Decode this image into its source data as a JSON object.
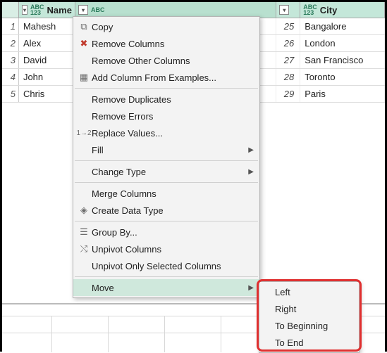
{
  "columns": {
    "name_header": "Name",
    "city_header": "City",
    "type_label": "ABC\n123"
  },
  "rows": [
    {
      "n": "1",
      "name": "Mahesh",
      "age": "25",
      "city": "Bangalore"
    },
    {
      "n": "2",
      "name": "Alex",
      "age": "26",
      "city": "London"
    },
    {
      "n": "3",
      "name": "David",
      "age": "27",
      "city": "San Francisco"
    },
    {
      "n": "4",
      "name": "John",
      "age": "28",
      "city": "Toronto"
    },
    {
      "n": "5",
      "name": "Chris",
      "age": "29",
      "city": "Paris"
    }
  ],
  "menu": {
    "copy": "Copy",
    "remove_columns": "Remove Columns",
    "remove_other_columns": "Remove Other Columns",
    "add_column_from_examples": "Add Column From Examples...",
    "remove_duplicates": "Remove Duplicates",
    "remove_errors": "Remove Errors",
    "replace_values": "Replace Values...",
    "fill": "Fill",
    "change_type": "Change Type",
    "merge_columns": "Merge Columns",
    "create_data_type": "Create Data Type",
    "group_by": "Group By...",
    "unpivot_columns": "Unpivot Columns",
    "unpivot_only_selected": "Unpivot Only Selected Columns",
    "move": "Move"
  },
  "submenu": {
    "left": "Left",
    "right": "Right",
    "to_beginning": "To Beginning",
    "to_end": "To End"
  }
}
